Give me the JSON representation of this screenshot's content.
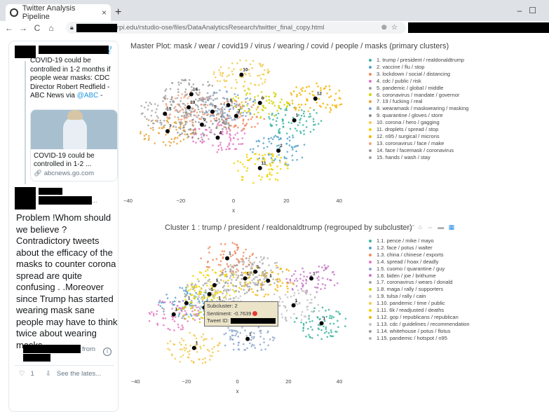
{
  "browser": {
    "tab_title": "Twitter Analysis Pipeline",
    "url_visible": "rpi.edu/rstudio-ose/files/DataAnalyticsResearch/twitter_final_copy.html"
  },
  "tweet": {
    "quoted_text": "COVID-19 could be controlled in 1-2 months if people wear masks: CDC Director Robert Redfield - ABC News via",
    "quoted_mention": "@ABC",
    "quoted_suffix": " -",
    "card_title": "COVID-19 could be controlled in 1-2 ...",
    "card_domain": "abcnews.go.com",
    "author_more": "...",
    "text": "Problem !Whom should we believe ? Contradictory tweets about the efficacy of the masks to counter corona spread are quite confusing . .Moreover since Trump has started wearing mask  sane people may have to think twice about wearing masks .",
    "from_label": "from",
    "likes": "1",
    "see_latest": "See the lates..."
  },
  "plot1": {
    "title": "Master Plot: mask / wear / covid19 / virus / wearing / covid / people / masks (primary clusters)",
    "xlabel": "x",
    "xticks": [
      "−40",
      "−20",
      "0",
      "20",
      "40"
    ]
  },
  "plot2": {
    "title": "Cluster 1 : trump / president / realdonaldtrump (regrouped by subcluster)",
    "xlabel": "x",
    "xticks": [
      "−40",
      "−20",
      "0",
      "20",
      "40"
    ],
    "tooltip": {
      "subcluster_label": "Subcluster: 2",
      "sentiment_label": "Sentiment: -0.7639",
      "tweet_id_label": "Tweet ID:"
    }
  },
  "chart_data": [
    {
      "type": "scatter",
      "title": "Master Plot: mask / wear / covid19 / virus / wearing / covid / people / masks (primary clusters)",
      "xlabel": "x",
      "xlim": [
        -42,
        43
      ],
      "series": [
        {
          "name": "1. trump / president / realdonaldtrump",
          "color": "#3cb4a0",
          "centroid": [
            23,
            4
          ]
        },
        {
          "name": "2. vaccine / flu / stop",
          "color": "#56a3c8",
          "centroid": [
            17,
            -10
          ]
        },
        {
          "name": "3. lockdown / social / distancing",
          "color": "#f08a5d",
          "centroid": [
            1,
            6
          ]
        },
        {
          "name": "4. cdc / public / risk",
          "color": "#e377c2",
          "centroid": [
            -6,
            -4
          ]
        },
        {
          "name": "5. pandemic / global / middle",
          "color": "#9d9d9d",
          "centroid": [
            -8,
            8
          ]
        },
        {
          "name": "6. coronavirus / mandate / governor",
          "color": "#d2d500",
          "centroid": [
            10,
            12
          ]
        },
        {
          "name": "7. 19 / fucking / real",
          "color": "#e7a33a",
          "centroid": [
            -25,
            -1
          ]
        },
        {
          "name": "8. wearamask / maskwearing / masking",
          "color": "#7fa3d8",
          "centroid": [
            -2,
            11
          ]
        },
        {
          "name": "9. quarantine / gloves / store",
          "color": "#8c8c8c",
          "centroid": [
            -12,
            2
          ]
        },
        {
          "name": "10. corona / hero / gagging",
          "color": "#f2c94c",
          "centroid": [
            3,
            25
          ]
        },
        {
          "name": "11. droplets / spread / stop",
          "color": "#f2d200",
          "centroid": [
            10,
            -18
          ]
        },
        {
          "name": "12. n95 / surgical / microns",
          "color": "#f4b400",
          "centroid": [
            31,
            14
          ]
        },
        {
          "name": "13. coronavirus / face / make",
          "color": "#f4a582",
          "centroid": [
            -17,
            10
          ]
        },
        {
          "name": "14. face / facemask / coronavirus",
          "color": "#9d9d9d",
          "centroid": [
            -16,
            16
          ]
        },
        {
          "name": "15. hands / wash / stay",
          "color": "#a5a5a5",
          "centroid": [
            -26,
            7
          ]
        }
      ]
    },
    {
      "type": "scatter",
      "title": "Cluster 1 : trump / president / realdonaldtrump (regrouped by subcluster)",
      "xlabel": "x",
      "xlim": [
        -45,
        43
      ],
      "series": [
        {
          "name": "1.1. pence / mike / mayo",
          "color": "#3cb4a0",
          "centroid": [
            33,
            -3
          ]
        },
        {
          "name": "1.2. face / potus / walter",
          "color": "#56a3c8",
          "centroid": [
            -20,
            6
          ]
        },
        {
          "name": "1.3. china / chinese / exports",
          "color": "#f08a5d",
          "centroid": [
            -4,
            26
          ]
        },
        {
          "name": "1.4. spread / hoax / deadly",
          "color": "#e377c2",
          "centroid": [
            -25,
            1
          ]
        },
        {
          "name": "1.5. cuomo / quarantine / guy",
          "color": "#8fa7cc",
          "centroid": [
            4,
            -10
          ]
        },
        {
          "name": "1.6. biden / joe / brithume",
          "color": "#c678c4",
          "centroid": [
            29,
            17
          ]
        },
        {
          "name": "1.7. coronavirus / wears / donald",
          "color": "#a5a5a5",
          "centroid": [
            -11,
            10
          ]
        },
        {
          "name": "1.8. maga / rally / supporters",
          "color": "#d2d500",
          "centroid": [
            -13,
            4
          ]
        },
        {
          "name": "1.9. tulsa / rally / cain",
          "color": "#c9c9c9",
          "centroid": [
            -8,
            6
          ]
        },
        {
          "name": "1.10. pandemic / time / public",
          "color": "#f2c94c",
          "centroid": [
            -17,
            -14
          ]
        },
        {
          "name": "1.11. 6k / readjusted / deaths",
          "color": "#f2d200",
          "centroid": [
            -9,
            14
          ]
        },
        {
          "name": "1.12. gop / republicans / republican",
          "color": "#f4b400",
          "centroid": [
            12,
            16
          ]
        },
        {
          "name": "1.13. cdc / guidelines / recommendation",
          "color": "#c2c2c2",
          "centroid": [
            22,
            5
          ]
        },
        {
          "name": "1.14. whitehouse / potus / flotus",
          "color": "#9d9d9d",
          "centroid": [
            3,
            17
          ]
        },
        {
          "name": "1.15. pandemic / hotspot / n95",
          "color": "#b3b3b3",
          "centroid": [
            7,
            20
          ]
        }
      ]
    }
  ]
}
